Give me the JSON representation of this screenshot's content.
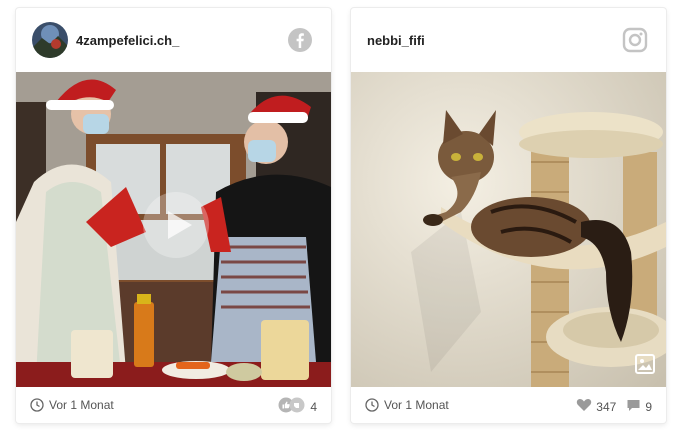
{
  "posts": [
    {
      "username": "4zampefelici.ch_",
      "network": "facebook-icon",
      "media_type": "video",
      "time": "Vor 1 Monat",
      "reactions": "4"
    },
    {
      "username": "nebbi_fifi",
      "network": "instagram-icon",
      "media_type": "image",
      "time": "Vor 1 Monat",
      "likes": "347",
      "comments": "9"
    }
  ],
  "colors": {
    "facebook": "#c4c4c4",
    "instagram": "#c4c4c4",
    "text": "#222222",
    "meta": "#555555"
  }
}
